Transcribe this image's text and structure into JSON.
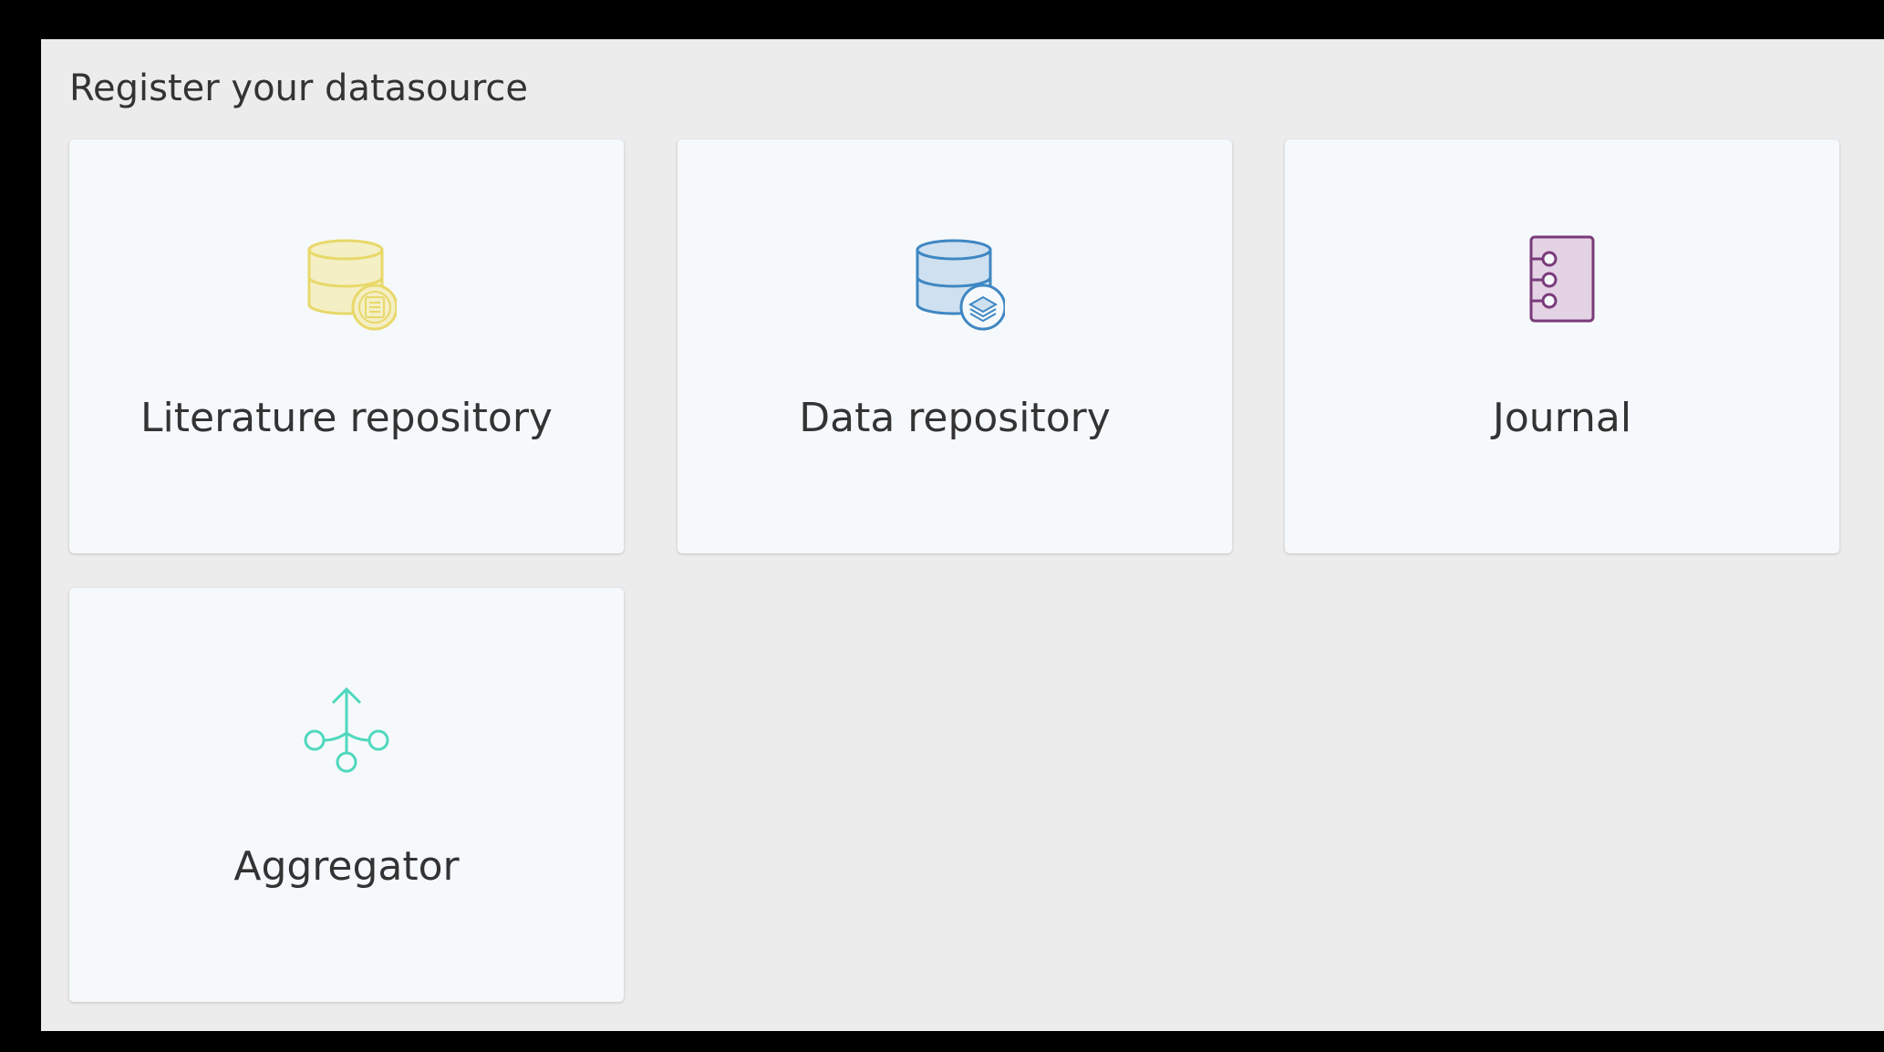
{
  "heading": "Register your datasource",
  "cards": [
    {
      "label": "Literature repository",
      "icon": "literature-database-icon",
      "color": "#e8d86a",
      "fill": "#f4efc4"
    },
    {
      "label": "Data repository",
      "icon": "data-database-icon",
      "color": "#3f87c3",
      "fill": "#cfe0f0"
    },
    {
      "label": "Journal",
      "icon": "journal-icon",
      "color": "#7a3b7a",
      "fill": "#e4d3e4"
    },
    {
      "label": "Aggregator",
      "icon": "aggregator-icon",
      "color": "#4fd8be"
    }
  ]
}
